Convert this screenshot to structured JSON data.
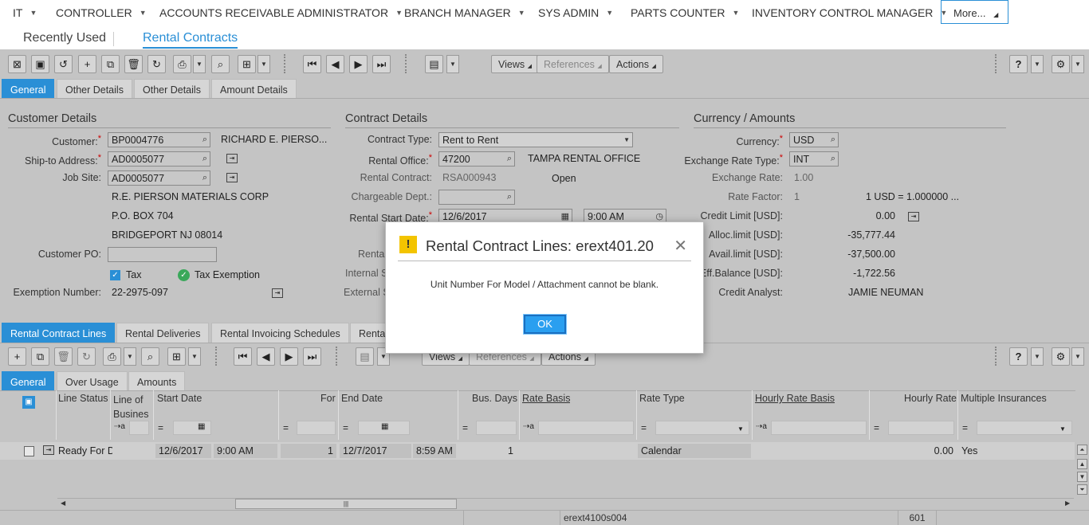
{
  "top_menu": {
    "items": [
      "IT",
      "CONTROLLER",
      "ACCOUNTS RECEIVABLE ADMINISTRATOR",
      "BRANCH MANAGER",
      "SYS ADMIN",
      "PARTS COUNTER",
      "INVENTORY CONTROL MANAGER"
    ],
    "more_label": "More..."
  },
  "nav_tabs": {
    "recent": "Recently Used",
    "active": "Rental Contracts"
  },
  "toolbar": {
    "views": "Views",
    "references": "References",
    "actions": "Actions"
  },
  "form_tabs": [
    "General",
    "Other Details",
    "Other Details",
    "Amount Details"
  ],
  "customer": {
    "header": "Customer Details",
    "customer_label": "Customer:",
    "customer_value": "BP0004776",
    "customer_name": "RICHARD E. PIERSO...",
    "shipto_label": "Ship-to Address:",
    "shipto_value": "AD0005077",
    "jobsite_label": "Job Site:",
    "jobsite_value": "AD0005077",
    "addr1": "R.E. PIERSON MATERIALS CORP",
    "addr2": "P.O. BOX 704",
    "addr3": "BRIDGEPORT  NJ  08014",
    "po_label": "Customer PO:",
    "po_value": "",
    "tax_label": "Tax",
    "tax_exempt_label": "Tax Exemption",
    "exemption_label": "Exemption Number:",
    "exemption_value": "22-2975-097"
  },
  "contract": {
    "header": "Contract Details",
    "type_label": "Contract Type:",
    "type_value": "Rent to Rent",
    "office_label": "Rental Office:",
    "office_value": "47200",
    "office_name": "TAMPA RENTAL OFFICE",
    "contract_label": "Rental Contract:",
    "contract_value": "RSA000943",
    "contract_status": "Open",
    "dept_label": "Chargeable Dept.:",
    "dept_value": "",
    "start_label": "Rental Start Date:",
    "start_date": "12/6/2017",
    "start_time": "9:00 AM",
    "rental_partial": "Renta",
    "internal_partial": "Internal S",
    "external_partial": "External S"
  },
  "currency": {
    "header": "Currency / Amounts",
    "currency_label": "Currency:",
    "currency_value": "USD",
    "exrate_type_label": "Exchange Rate Type:",
    "exrate_type_value": "INT",
    "exrate_label": "Exchange Rate:",
    "exrate_value": "1.00",
    "factor_label": "Rate Factor:",
    "factor_value": "1",
    "factor_text": "1  USD  =  1.000000  ...",
    "credit_label": "Credit Limit [USD]:",
    "credit_value": "0.00",
    "alloc_label": "Alloc.limit [USD]:",
    "alloc_value": "-35,777.44",
    "avail_label": "Avail.limit [USD]:",
    "avail_value": "-37,500.00",
    "eff_label": "Eff.Balance [USD]:",
    "eff_value": "-1,722.56",
    "analyst_label": "Credit Analyst:",
    "analyst_value": "JAMIE NEUMAN"
  },
  "lines_tabs": [
    "Rental Contract Lines",
    "Rental Deliveries",
    "Rental Invoicing Schedules",
    "Renta"
  ],
  "lines_toolbar": {
    "views": "Views",
    "references": "References",
    "actions": "Actions"
  },
  "line_subtabs": [
    "General",
    "Over Usage",
    "Amounts"
  ],
  "columns": [
    "Line Status",
    "Line of Busines",
    "Start Date",
    "For",
    "End Date",
    "Bus. Days",
    "Rate Basis",
    "Rate Type",
    "Hourly Rate Basis",
    "Hourly Rate",
    "Multiple Insurances"
  ],
  "row": {
    "status": "Ready For D",
    "start_date": "12/6/2017",
    "start_time": "9:00 AM",
    "for": "1",
    "end_date": "12/7/2017",
    "end_time": "8:59 AM",
    "bus_days": "1",
    "rate_type": "Calendar",
    "hourly_rate": "0.00",
    "multi_ins": "Yes"
  },
  "status_bar": {
    "session": "erext4100s004",
    "code": "601"
  },
  "dialog": {
    "title": "Rental Contract Lines: erext401.20",
    "message": "Unit Number For Model / Attachment cannot be blank.",
    "ok": "OK"
  },
  "colors": {
    "accent": "#2a8fd6",
    "warning": "#f3c400",
    "overlay": "#c4c4c4"
  }
}
